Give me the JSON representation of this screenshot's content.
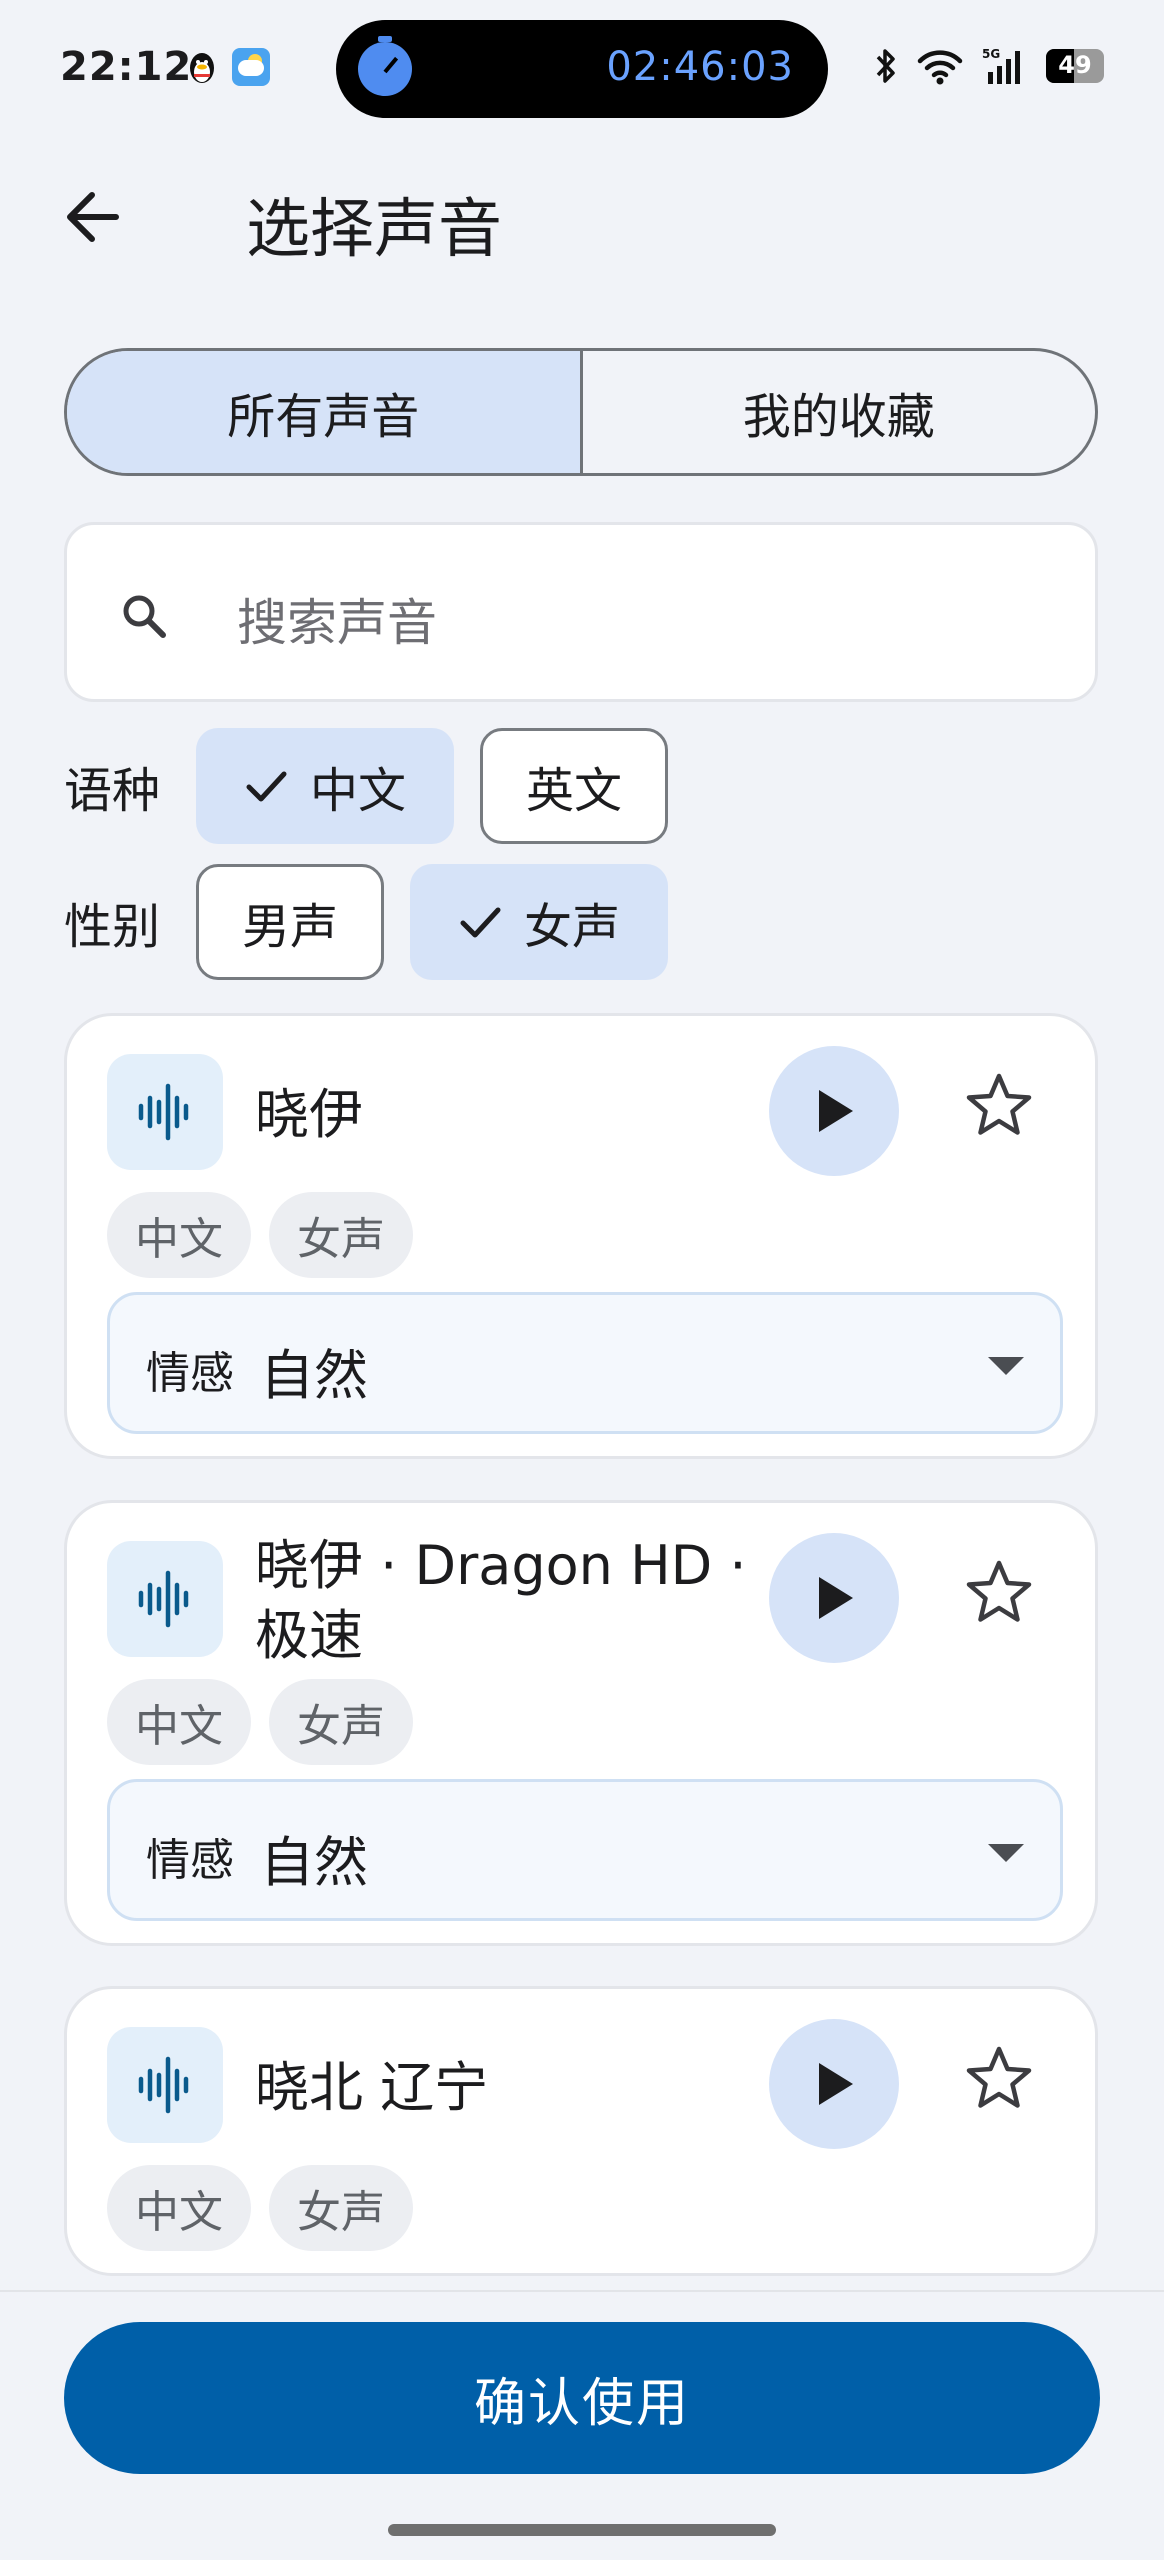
{
  "status_bar": {
    "time": "22:12",
    "timer": "02:46:03",
    "battery": "49",
    "battery_level_percent": 49
  },
  "header": {
    "title": "选择声音",
    "back_icon": "arrow-left-icon"
  },
  "tabs": [
    {
      "label": "所有声音",
      "active": true
    },
    {
      "label": "我的收藏",
      "active": false
    }
  ],
  "search": {
    "placeholder": "搜索声音",
    "icon": "search-icon"
  },
  "filters": {
    "language": {
      "label": "语种",
      "options": [
        {
          "label": "中文",
          "selected": true
        },
        {
          "label": "英文",
          "selected": false
        }
      ]
    },
    "gender": {
      "label": "性别",
      "options": [
        {
          "label": "男声",
          "selected": false
        },
        {
          "label": "女声",
          "selected": true
        }
      ]
    }
  },
  "voices": [
    {
      "name": "晓伊",
      "tags": [
        "中文",
        "女声"
      ],
      "emotion_label": "情感",
      "emotion_value": "自然"
    },
    {
      "name": "晓伊 · Dragon HD · 极速",
      "tags": [
        "中文",
        "女声"
      ],
      "emotion_label": "情感",
      "emotion_value": "自然"
    },
    {
      "name": "晓北 辽宁",
      "tags": [
        "中文",
        "女声"
      ]
    }
  ],
  "confirm_button": "确认使用",
  "colors": {
    "accent": "#005fa8",
    "selected_chip": "#d6e3f8",
    "background": "#f1f3f8",
    "avatar_bg": "#e3effa",
    "waveform": "#0a5a8c"
  }
}
